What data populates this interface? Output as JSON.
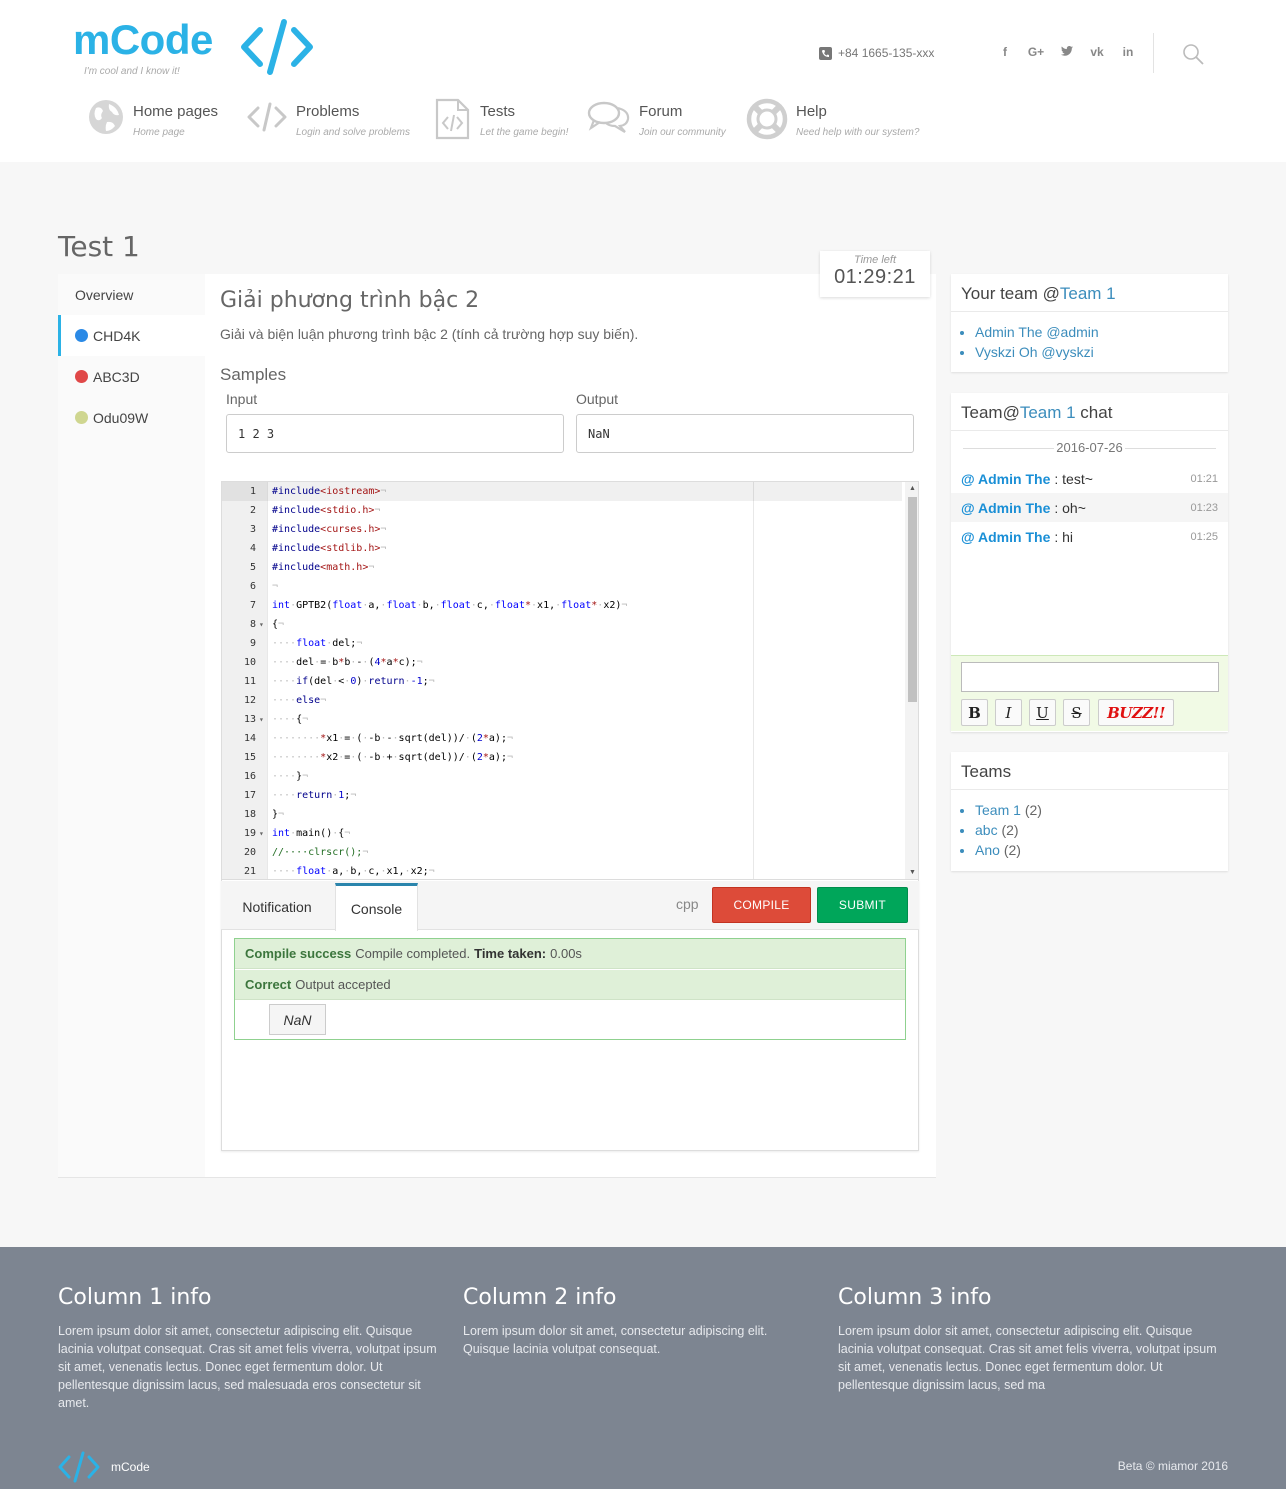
{
  "header": {
    "logo_text": "mCode",
    "logo_tagline": "I'm cool and I know it!",
    "phone": "+84 1665-135-xxx",
    "social": [
      "f",
      "G+",
      "t",
      "vk",
      "in"
    ],
    "nav": [
      {
        "title": "Home pages",
        "subtitle": "Home page",
        "icon": "globe-icon"
      },
      {
        "title": "Problems",
        "subtitle": "Login and solve problems",
        "icon": "code-icon"
      },
      {
        "title": "Tests",
        "subtitle": "Let the game begin!",
        "icon": "code-file-icon"
      },
      {
        "title": "Forum",
        "subtitle": "Join our community",
        "icon": "chat-bubbles-icon"
      },
      {
        "title": "Help",
        "subtitle": "Need help with our system?",
        "icon": "lifebuoy-icon"
      }
    ]
  },
  "page": {
    "title": "Test 1",
    "sidebar": [
      {
        "label": "Overview",
        "color": null
      },
      {
        "label": "CHD4K",
        "color": "#2b8ae6"
      },
      {
        "label": "ABC3D",
        "color": "#e04848"
      },
      {
        "label": "Odu09W",
        "color": "#cfd690"
      }
    ],
    "timer": {
      "label": "Time left",
      "value": "01:29:21"
    },
    "problem": {
      "title": "Giải phương trình bậc 2",
      "description": "Giải và biện luận phương trình bậc 2 (tính cả trường hợp suy biến).",
      "samples_heading": "Samples",
      "input_label": "Input",
      "output_label": "Output",
      "input_value": "1 2 3",
      "output_value": "NaN"
    },
    "editor": {
      "lines": [
        "1",
        "2",
        "3",
        "4",
        "5",
        "6",
        "7",
        "8",
        "9",
        "10",
        "11",
        "12",
        "13",
        "14",
        "15",
        "16",
        "17",
        "18",
        "19",
        "20",
        "21"
      ]
    },
    "bottom": {
      "tab_notification": "Notification",
      "tab_console": "Console",
      "language": "cpp",
      "compile_label": "COMPILE",
      "submit_label": "SUBMIT",
      "compile_status": "Compile success",
      "compile_msg": "Compile completed.",
      "time_label": "Time taken:",
      "time_value": "0.00s",
      "result_status": "Correct",
      "result_msg": "Output accepted",
      "output": "NaN"
    }
  },
  "right": {
    "team_widget": {
      "title_prefix": "Your team @",
      "team_name": "Team 1",
      "members": [
        {
          "name": "Admin The",
          "handle": "@admin"
        },
        {
          "name": "Vyskzi Oh",
          "handle": "@vyskzi"
        }
      ]
    },
    "chat_widget": {
      "title_prefix": "Team@",
      "team_name": "Team 1",
      "title_suffix": " chat",
      "date": "2016-07-26",
      "messages": [
        {
          "user": "@ Admin The",
          "text": ": test~",
          "time": "01:21"
        },
        {
          "user": "@ Admin The",
          "text": ": oh~",
          "time": "01:23"
        },
        {
          "user": "@ Admin The",
          "text": ": hi",
          "time": "01:25"
        }
      ],
      "buttons": {
        "bold": "B",
        "italic": "I",
        "underline": "U",
        "strike": "S",
        "buzz": "BUZZ!!"
      }
    },
    "teams_widget": {
      "title": "Teams",
      "teams": [
        {
          "name": "Team 1",
          "count": "(2)"
        },
        {
          "name": "abc",
          "count": "(2)"
        },
        {
          "name": "Ano",
          "count": "(2)"
        }
      ]
    }
  },
  "footer": {
    "columns": [
      {
        "title": "Column 1 info",
        "text": "Lorem ipsum dolor sit amet, consectetur adipiscing elit. Quisque lacinia volutpat consequat. Cras sit amet felis viverra, volutpat ipsum sit amet, venenatis lectus. Donec eget fermentum dolor. Ut pellentesque dignissim lacus, sed malesuada eros consectetur sit amet."
      },
      {
        "title": "Column 2 info",
        "text": "Lorem ipsum dolor sit amet, consectetur adipiscing elit. Quisque lacinia volutpat consequat."
      },
      {
        "title": "Column 3 info",
        "text": "Lorem ipsum dolor sit amet, consectetur adipiscing elit. Quisque lacinia volutpat consequat. Cras sit amet felis viverra, volutpat ipsum sit amet, venenatis lectus. Donec eget fermentum dolor. Ut pellentesque dignissim lacus, sed ma"
      }
    ],
    "logo_text": "mCode",
    "copyright": "Beta © miamor 2016"
  },
  "colors": {
    "brand": "#2bb2e6",
    "link": "#3c8dbc",
    "compile": "#dd4b39",
    "submit": "#00a65a"
  }
}
